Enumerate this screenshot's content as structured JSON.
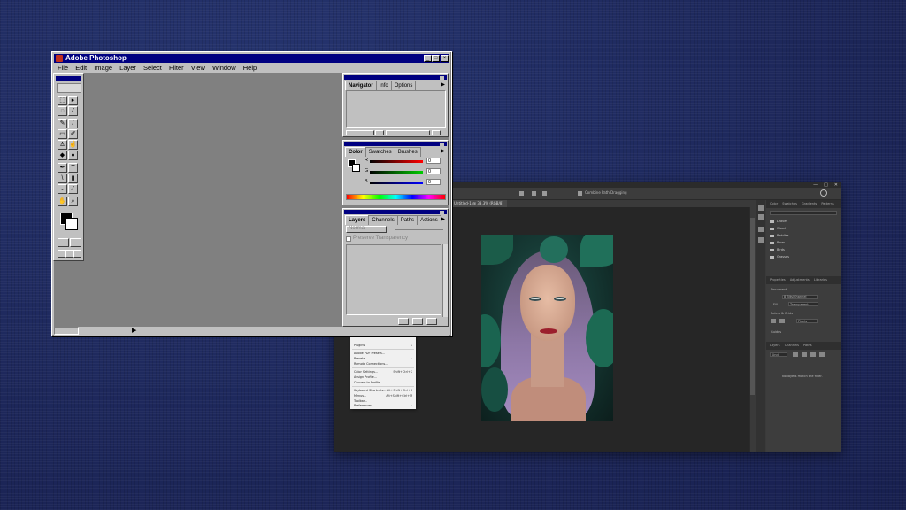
{
  "modern": {
    "options_text": "Combine Path Dragging",
    "doc_tab": "Untitled-1 @ 33.3% (RGB/8)",
    "panel_tabs": [
      "Color",
      "Swatches",
      "Gradients",
      "Patterns"
    ],
    "search_placeholder": "Search Shapes",
    "folders": [
      "Leaves",
      "Wood",
      "Peddles",
      "Pines",
      "Birds",
      "Grasses"
    ],
    "properties_tabs": [
      "Properties",
      "Adjustments",
      "Libraries"
    ],
    "properties": {
      "document": "Document",
      "mode_label": "8 Bits/Channel",
      "fill_label": "Fill",
      "fill_value": "Transparent",
      "rulers": "Rulers & Grids",
      "unit": "Pixels",
      "guides": "Guides"
    },
    "layers_tabs": [
      "Layers",
      "Channels",
      "Paths"
    ],
    "layers_filter": "Kind",
    "layers_empty": "No layers match the filter."
  },
  "menu": {
    "items": [
      {
        "label": "Plugins",
        "key": "▸"
      },
      {
        "label": "Presets",
        "key": "▸"
      },
      {
        "label": "Remote Connections...",
        "key": ""
      },
      {
        "label": "Adobe PDF Presets...",
        "key": ""
      },
      {
        "label": "Presets",
        "key": "▸"
      },
      {
        "label": "Remote Connections...",
        "key": ""
      },
      {
        "label": "Color Settings...",
        "key": "Shift+Ctrl+K"
      },
      {
        "label": "Assign Profile...",
        "key": ""
      },
      {
        "label": "Convert to Profile...",
        "key": ""
      },
      {
        "label": "Keyboard Shortcuts...",
        "key": "Alt+Shift+Ctrl+K"
      },
      {
        "label": "Menus...",
        "key": "Alt+Shift+Ctrl+M"
      },
      {
        "label": "Toolbar...",
        "key": ""
      },
      {
        "label": "Preferences",
        "key": "▸"
      }
    ]
  },
  "classic": {
    "title": "Adobe Photoshop",
    "menus": [
      "File",
      "Edit",
      "Image",
      "Layer",
      "Select",
      "Filter",
      "View",
      "Window",
      "Help"
    ],
    "navigator_tabs": [
      "Navigator",
      "Info",
      "Options"
    ],
    "color_tabs": [
      "Color",
      "Swatches",
      "Brushes"
    ],
    "channels": [
      {
        "label": "R",
        "value": "0",
        "color": "#d00000"
      },
      {
        "label": "G",
        "value": "0",
        "color": "#00a000"
      },
      {
        "label": "B",
        "value": "0",
        "color": "#0000d0"
      }
    ],
    "layers_tabs": [
      "Layers",
      "Channels",
      "Paths",
      "Actions"
    ],
    "blend_mode": "Normal",
    "preserve_transparency": "Preserve Transparency",
    "foreground_color": "#000000",
    "background_color": "#ffffff"
  },
  "colors": {
    "desktop": "#1f2a5e",
    "classic_title": "#000080",
    "modern_bg": "#3a3a3a"
  }
}
